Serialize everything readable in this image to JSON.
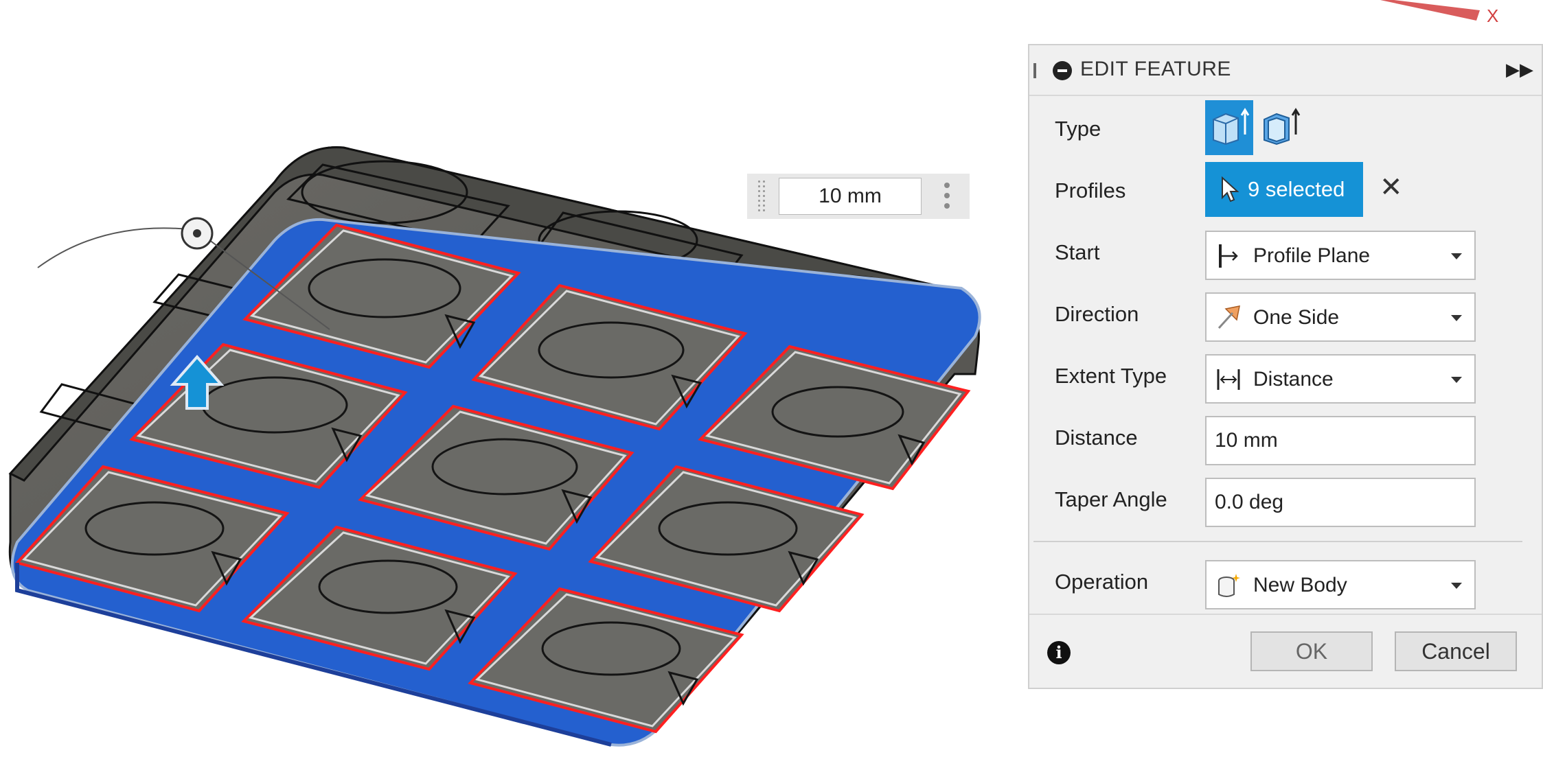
{
  "manipulator": {
    "distance_value": "10 mm"
  },
  "panel": {
    "title": "EDIT FEATURE",
    "type_label": "Type",
    "profiles_label": "Profiles",
    "profiles_value": "9 selected",
    "start_label": "Start",
    "start_value": "Profile Plane",
    "direction_label": "Direction",
    "direction_value": "One Side",
    "extent_label": "Extent Type",
    "extent_value": "Distance",
    "distance_label": "Distance",
    "distance_value": "10 mm",
    "taper_label": "Taper Angle",
    "taper_value": "0.0 deg",
    "operation_label": "Operation",
    "operation_value": "New Body",
    "ok_label": "OK",
    "cancel_label": "Cancel"
  },
  "colors": {
    "accent": "#1592d6",
    "selection": "#1f5fd6",
    "profile_edge": "#ff2020",
    "body": "#5f5f5a"
  },
  "axis": {
    "x_label": "X"
  }
}
